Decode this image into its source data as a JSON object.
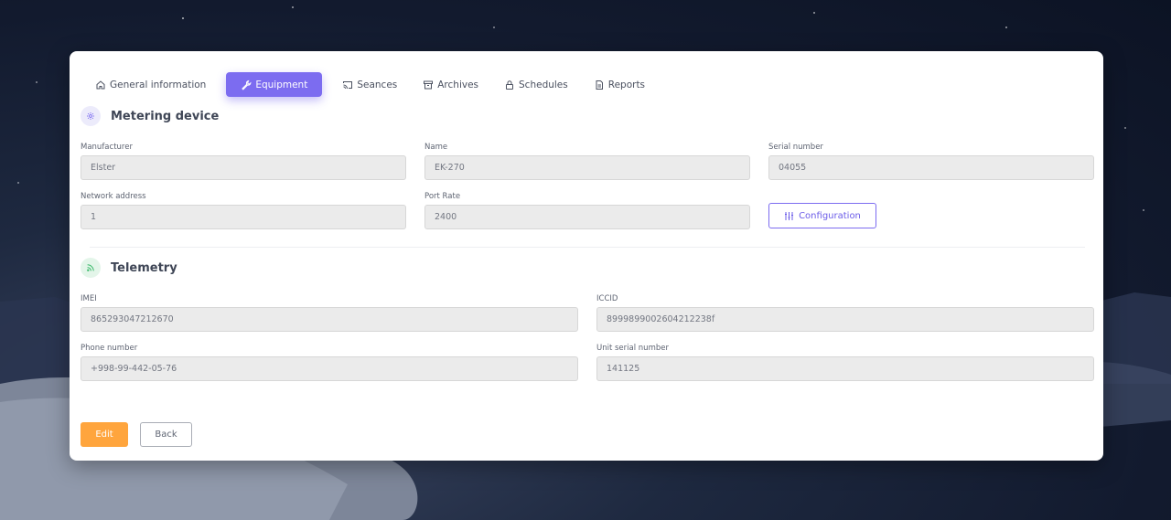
{
  "tabs": [
    {
      "label": "General information",
      "icon": "home-icon"
    },
    {
      "label": "Equipment",
      "icon": "wrench-icon"
    },
    {
      "label": "Seances",
      "icon": "cast-icon"
    },
    {
      "label": "Archives",
      "icon": "archive-icon"
    },
    {
      "label": "Schedules",
      "icon": "lock-icon"
    },
    {
      "label": "Reports",
      "icon": "document-icon"
    }
  ],
  "active_tab": "Equipment",
  "metering": {
    "title": "Metering device",
    "icon": "gear-icon",
    "manufacturer": {
      "label": "Manufacturer",
      "value": "Elster"
    },
    "name": {
      "label": "Name",
      "value": "EK-270"
    },
    "serial": {
      "label": "Serial number",
      "value": "04055"
    },
    "network": {
      "label": "Network address",
      "value": "1"
    },
    "port_rate": {
      "label": "Port Rate",
      "value": "2400"
    },
    "configuration_label": "Configuration"
  },
  "telemetry": {
    "title": "Telemetry",
    "icon": "rss-icon",
    "imei": {
      "label": "IMEI",
      "value": "865293047212670"
    },
    "iccid": {
      "label": "ICCID",
      "value": "8999899002604212238f"
    },
    "phone": {
      "label": "Phone number",
      "value": "+998-99-442-05-76"
    },
    "unit_serial": {
      "label": "Unit serial number",
      "value": "141125"
    }
  },
  "actions": {
    "edit_label": "Edit",
    "back_label": "Back"
  },
  "colors": {
    "accent": "#7c6cf0",
    "edit": "#ffa53d",
    "telemetry_icon": "#3dba6c"
  }
}
